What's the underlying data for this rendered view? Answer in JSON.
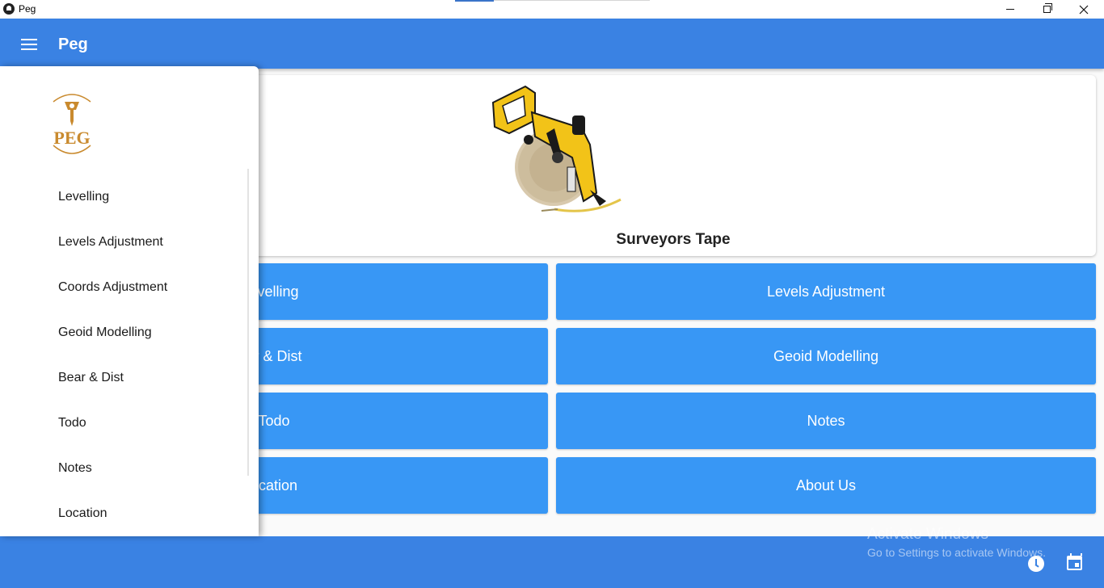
{
  "window": {
    "title": "Peg"
  },
  "appbar": {
    "title": "Peg"
  },
  "hero": {
    "caption": "Surveyors Tape"
  },
  "buttons": {
    "left": [
      "evelling",
      "ar & Dist",
      "Todo",
      "ocation"
    ],
    "right": [
      "Levels Adjustment",
      "Geoid Modelling",
      "Notes",
      "About Us"
    ]
  },
  "drawer": {
    "logo_text": "PEG",
    "items": [
      "Levelling",
      "Levels Adjustment",
      "Coords Adjustment",
      "Geoid Modelling",
      "Bear & Dist",
      "Todo",
      "Notes",
      "Location"
    ]
  },
  "watermark": {
    "line1": "Activate Windows",
    "line2": "Go to Settings to activate Windows."
  },
  "colors": {
    "primary": "#3a82e3",
    "button": "#3897f5",
    "logo": "#c98a2e"
  },
  "icons": [
    "menu-icon",
    "clock-icon",
    "calendar-icon"
  ]
}
